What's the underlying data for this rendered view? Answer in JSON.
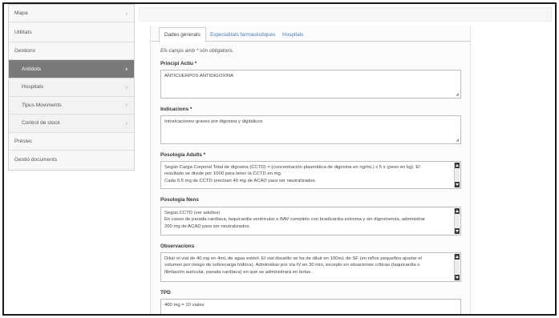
{
  "sidebar": {
    "items": [
      {
        "label": "Mapa",
        "chevron": "›"
      },
      {
        "label": "Utilitats",
        "chevron": ""
      },
      {
        "label": "Gestions",
        "chevron": ""
      },
      {
        "label": "Antídots",
        "chevron": "›"
      },
      {
        "label": "Hospitals",
        "chevron": "›"
      },
      {
        "label": "Tipus Moviments",
        "chevron": "›"
      },
      {
        "label": "Control de stock",
        "chevron": "›"
      },
      {
        "label": "Préstec",
        "chevron": ""
      },
      {
        "label": "Gestió documents",
        "chevron": ""
      }
    ]
  },
  "tabs": [
    "Dades generals",
    "Especialitats farmacèutiques",
    "Hospitals"
  ],
  "form": {
    "note": "Els camps amb * són obligatoris.",
    "principi_actiu": {
      "label": "Principi Actiu *",
      "value": "ANTICUERPOS ANTIDIGOXINA"
    },
    "indicacions": {
      "label": "Indicacions *",
      "value": "Intoxicaciones graves por digoxina y digitálicos"
    },
    "posologia_adults": {
      "label": "Posologia Adults *",
      "lines": [
        "Según Carga Corporal Total de digoxina (CCTD) = (concentración plasmática de digoxina en ng/mL) x 5 x (peso en kg). El",
        "resultado se divide por 1000 para tener la CCTD en mg.",
        "Cada 0.5 mg de CCTD precisan 40 mg de ACAD para ser neutralizados."
      ]
    },
    "posologia_nens": {
      "label": "Posologia Nens",
      "lines": [
        "Según CCTD (ver adultos)",
        "En casos de parada cardíaca, taquicardia ventricular o BAV completo con bradicardia extrema y sin digoxinemia, administrar",
        "200 mg de ACAD para ser neutralizados."
      ]
    },
    "observacions": {
      "label": "Observacions",
      "lines": [
        "Diluir el vial de 40 mg en 4mL de agua estéril. El vial disuelto se ha de diluir en 100mL de SF (en niños pequeños ajustar el",
        "volumen por riesgo de sobrecarga hídrica). Administrar por vía IV en 30 min, excepto en situaciones críticas (taquicardia o",
        "fibrilación auricular, parada cardíaca) en que se administrará en  bolus."
      ]
    },
    "tpd": {
      "label": "TPD",
      "value": "400 mg = 10 viales"
    }
  }
}
